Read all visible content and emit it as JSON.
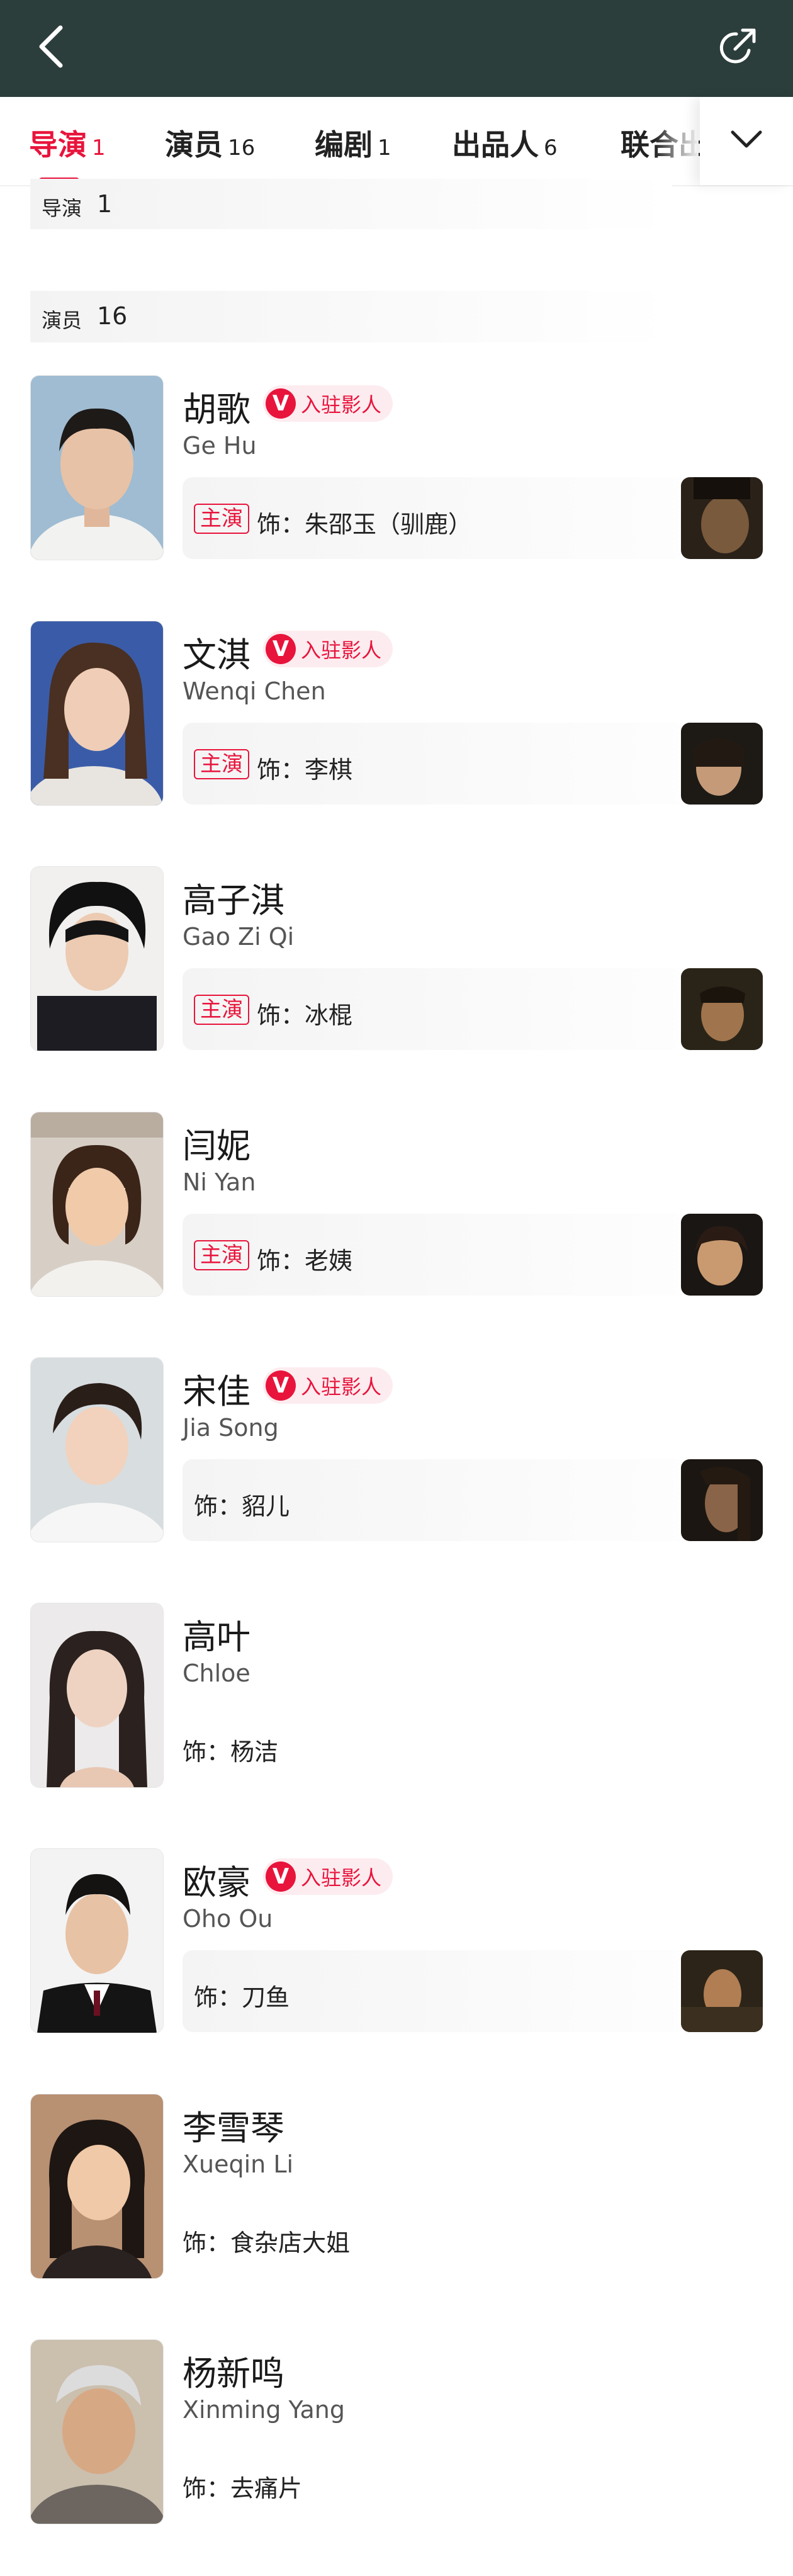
{
  "nav": {
    "back_icon": "back-chevron-icon",
    "share_icon": "share-icon"
  },
  "tabs": [
    {
      "label": "导演",
      "count": "1",
      "active": true
    },
    {
      "label": "演员",
      "count": "16"
    },
    {
      "label": "编剧",
      "count": "1"
    },
    {
      "label": "出品人",
      "count": "6"
    },
    {
      "label": "联合出"
    }
  ],
  "sections": {
    "director": {
      "label": "导演",
      "count": "1"
    },
    "cast": {
      "label": "演员",
      "count": "16"
    }
  },
  "badge_text": "入驻影人",
  "badge_letter": "V",
  "lead_tag": "主演",
  "cast": [
    {
      "name_cn": "胡歌",
      "name_en": "Ge Hu",
      "verified": true,
      "lead": true,
      "role": "饰：朱邵玉（驯鹿）",
      "has_thumb": true
    },
    {
      "name_cn": "文淇",
      "name_en": "Wenqi Chen",
      "verified": true,
      "lead": true,
      "role": "饰：李棋",
      "has_thumb": true
    },
    {
      "name_cn": "高子淇",
      "name_en": "Gao Zi Qi",
      "verified": false,
      "lead": true,
      "role": "饰：冰棍",
      "has_thumb": true
    },
    {
      "name_cn": "闫妮",
      "name_en": "Ni Yan",
      "verified": false,
      "lead": true,
      "role": "饰：老姨",
      "has_thumb": true
    },
    {
      "name_cn": "宋佳",
      "name_en": "Jia Song",
      "verified": true,
      "lead": false,
      "role": "饰：貂儿",
      "has_thumb": true
    },
    {
      "name_cn": "高叶",
      "name_en": "Chloe",
      "verified": false,
      "lead": false,
      "role": "饰：杨洁",
      "has_thumb": false
    },
    {
      "name_cn": "欧豪",
      "name_en": "Oho Ou",
      "verified": true,
      "lead": false,
      "role": "饰：刀鱼",
      "has_thumb": true
    },
    {
      "name_cn": "李雪琴",
      "name_en": "Xueqin Li",
      "verified": false,
      "lead": false,
      "role": "饰：食杂店大姐",
      "has_thumb": false
    },
    {
      "name_cn": "杨新鸣",
      "name_en": "Xinming Yang",
      "verified": false,
      "lead": false,
      "role": "饰：去痛片",
      "has_thumb": false
    }
  ]
}
